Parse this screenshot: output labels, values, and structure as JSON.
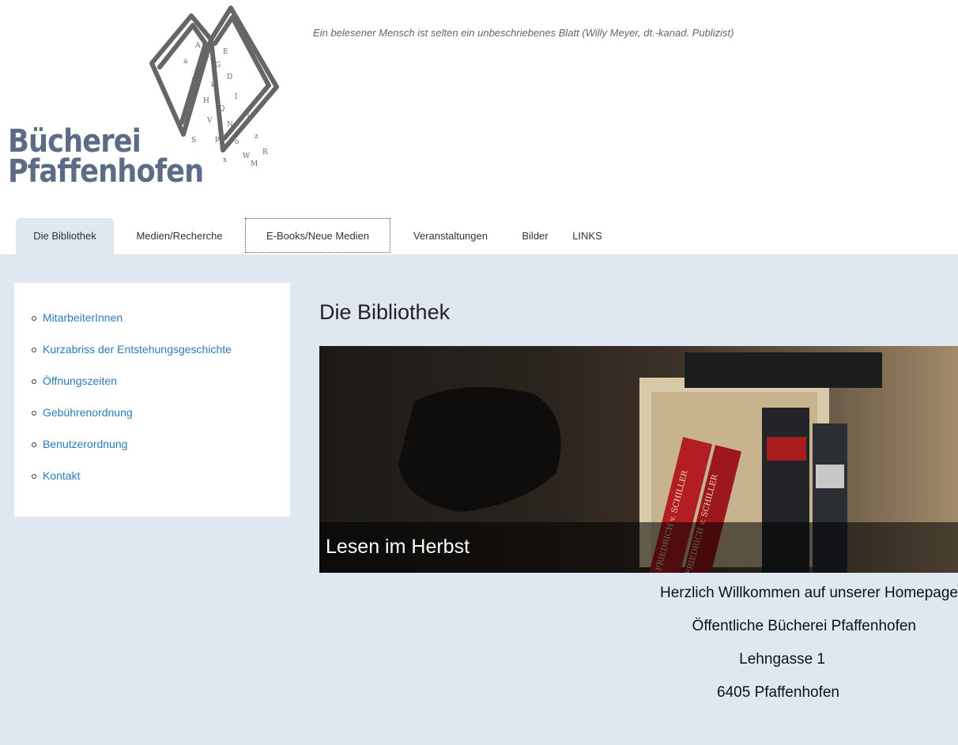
{
  "header": {
    "logo_line1": "Bücherei",
    "logo_line2": "Pfaffenhofen",
    "slogan": "Ein belesener Mensch ist selten ein unbeschriebenes Blatt (Willy Meyer, dt.-kanad. Publizist)"
  },
  "nav": {
    "tabs": [
      {
        "label": "Die Bibliothek"
      },
      {
        "label": "Medien/Recherche"
      },
      {
        "label": "E-Books/Neue Medien"
      },
      {
        "label": "Veranstaltungen"
      },
      {
        "label": "Bilder"
      },
      {
        "label": "LINKS"
      }
    ]
  },
  "sidebar": {
    "items": [
      {
        "label": "MitarbeiterInnen"
      },
      {
        "label": "Kurzabriss der Entstehungsgeschichte"
      },
      {
        "label": "Öffnungszeiten"
      },
      {
        "label": "Gebührenordnung"
      },
      {
        "label": "Benutzerordnung"
      },
      {
        "label": "Kontakt"
      }
    ]
  },
  "main": {
    "title": "Die Bibliothek",
    "hero_caption": "Lesen im Herbst",
    "lines": [
      "Herzlich Willkommen auf unserer Homepage",
      "Öffentliche Bücherei Pfaffenhofen",
      "Lehngasse 1",
      "6405 Pfaffenhofen"
    ],
    "hero_spines": [
      "FRIEDRICH v. SCHILLER",
      "FRIEDRICH v. SCHILLER"
    ]
  },
  "colors": {
    "link": "#2b7bb9",
    "content_bg": "#dfe7f0",
    "logo": "#5d6c86"
  }
}
